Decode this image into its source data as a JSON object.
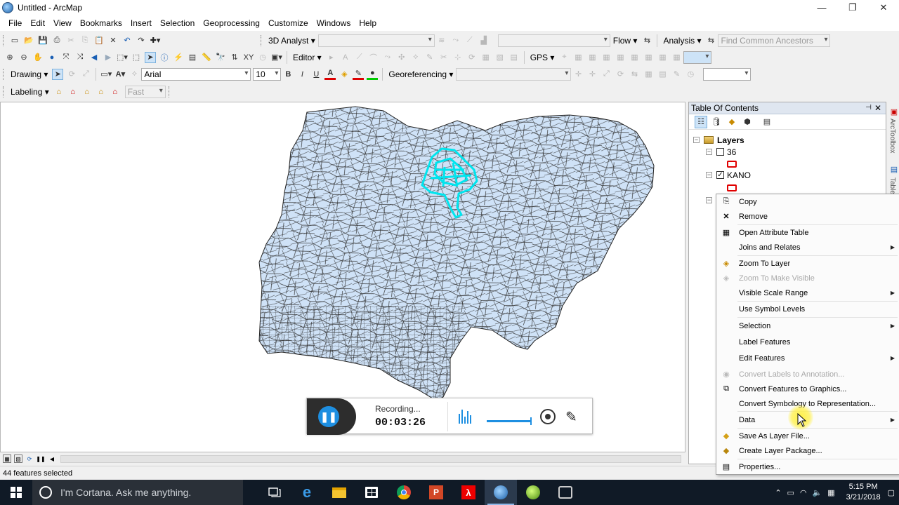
{
  "window": {
    "title": "Untitled - ArcMap",
    "min": "—",
    "max": "❐",
    "close": "✕"
  },
  "menu": [
    "File",
    "Edit",
    "View",
    "Bookmarks",
    "Insert",
    "Selection",
    "Geoprocessing",
    "Customize",
    "Windows",
    "Help"
  ],
  "toolbar1": {
    "analyst3d": "3D Analyst ▾",
    "flow": "Flow ▾",
    "analysis": "Analysis ▾",
    "find_ancestors_placeholder": "Find Common Ancestors"
  },
  "toolbar2": {
    "editor": "Editor ▾",
    "gps": "GPS ▾"
  },
  "toolbar3": {
    "drawing": "Drawing ▾",
    "font": "Arial",
    "font_size": "10",
    "bold": "B",
    "italic": "I",
    "underline": "U",
    "georef": "Georeferencing ▾"
  },
  "toolbar4": {
    "labeling": "Labeling ▾",
    "fast": "Fast"
  },
  "toc": {
    "title": "Table Of Contents",
    "root": "Layers",
    "layers": [
      {
        "name": "36",
        "checked": false
      },
      {
        "name": "KANO",
        "checked": true
      }
    ]
  },
  "side_strip": {
    "text1": "ArcToolbox",
    "text2": "Table"
  },
  "context_menu": {
    "items": [
      {
        "label": "Copy",
        "icon": "copy-icon",
        "disabled": false,
        "submenu": false
      },
      {
        "label": "Remove",
        "icon": "remove-icon",
        "disabled": false,
        "submenu": false
      },
      {
        "label": "Open Attribute Table",
        "icon": "table-icon",
        "disabled": false,
        "submenu": false
      },
      {
        "label": "Joins and Relates",
        "icon": "",
        "disabled": false,
        "submenu": true
      },
      {
        "label": "Zoom To Layer",
        "icon": "zoom-layer-icon",
        "disabled": false,
        "submenu": false
      },
      {
        "label": "Zoom To Make Visible",
        "icon": "zoom-visible-icon",
        "disabled": true,
        "submenu": false
      },
      {
        "label": "Visible Scale Range",
        "icon": "",
        "disabled": false,
        "submenu": true
      },
      {
        "label": "Use Symbol Levels",
        "icon": "",
        "disabled": false,
        "submenu": false
      },
      {
        "label": "Selection",
        "icon": "",
        "disabled": false,
        "submenu": true
      },
      {
        "label": "Label Features",
        "icon": "",
        "disabled": false,
        "submenu": false
      },
      {
        "label": "Edit Features",
        "icon": "",
        "disabled": false,
        "submenu": true
      },
      {
        "label": "Convert Labels to Annotation...",
        "icon": "convert-labels-icon",
        "disabled": true,
        "submenu": false
      },
      {
        "label": "Convert Features to Graphics...",
        "icon": "convert-graphics-icon",
        "disabled": false,
        "submenu": false
      },
      {
        "label": "Convert Symbology to Representation...",
        "icon": "",
        "disabled": false,
        "submenu": false
      },
      {
        "label": "Data",
        "icon": "",
        "disabled": false,
        "submenu": true
      },
      {
        "label": "Save As Layer File...",
        "icon": "layer-file-icon",
        "disabled": false,
        "submenu": false
      },
      {
        "label": "Create Layer Package...",
        "icon": "layer-package-icon",
        "disabled": false,
        "submenu": false
      },
      {
        "label": "Properties...",
        "icon": "properties-icon",
        "disabled": false,
        "submenu": false
      }
    ]
  },
  "recorder": {
    "status": "Recording...",
    "time": "00:03:26"
  },
  "statusbar": {
    "text": "44 features selected"
  },
  "taskbar": {
    "search_placeholder": "I'm Cortana. Ask me anything.",
    "time": "5:15 PM",
    "date": "3/21/2018"
  },
  "colors": {
    "map_fill": "#cfe2f7",
    "selection": "#00e5ee",
    "accent": "#1e8fe1"
  }
}
